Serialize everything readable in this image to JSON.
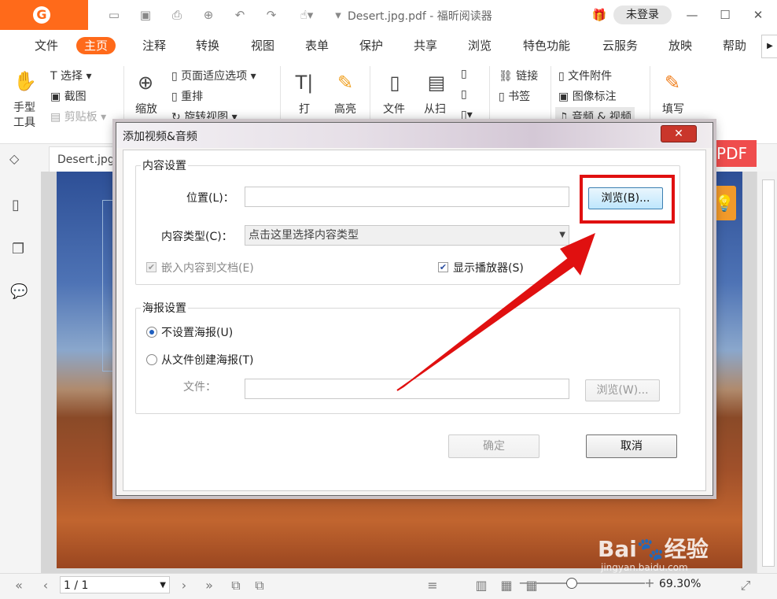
{
  "app": {
    "document_title": "Desert.jpg.pdf - 福昕阅读器",
    "login_label": "未登录"
  },
  "menu": {
    "items": [
      "文件",
      "主页",
      "注释",
      "转换",
      "视图",
      "表单",
      "保护",
      "共享",
      "浏览",
      "特色功能",
      "云服务",
      "放映",
      "帮助"
    ],
    "active": "主页"
  },
  "ribbon": {
    "hand_tool": "手型\n工具",
    "select": "选择",
    "screenshot": "截图",
    "clipboard": "剪贴板",
    "zoom": "缩放",
    "page_fit": "页面适应选项",
    "rearrange": "重排",
    "rotate_view": "旋转视图",
    "typewriter": "打",
    "highlight": "高亮",
    "file_convert": "文件",
    "from_scanner": "从扫",
    "link": "链接",
    "bookmark": "书签",
    "file_attachment": "文件附件",
    "image_annotation": "图像标注",
    "audio_video": "音频 & 视频",
    "fill_sign": "填写"
  },
  "document": {
    "tab_label": "Desert.jpg.",
    "promo_text": "转PDF"
  },
  "statusbar": {
    "page": "1 / 1",
    "zoom": "69.30%",
    "zoom_fraction": 0.33
  },
  "dialog": {
    "title": "添加视频&音频",
    "content_settings": {
      "group_title": "内容设置",
      "location_label": "位置(L)：",
      "location_value": "",
      "browse_label": "浏览(B)...",
      "content_type_label": "内容类型(C)：",
      "content_type_placeholder": "点击这里选择内容类型",
      "embed_label": "嵌入内容到文档(E)",
      "embed_checked": true,
      "show_player_label": "显示播放器(S)",
      "show_player_checked": true
    },
    "poster_settings": {
      "group_title": "海报设置",
      "no_poster_label": "不设置海报(U)",
      "from_file_label": "从文件创建海报(T)",
      "file_label": "文件：",
      "file_value": "",
      "browse_label": "浏览(W)..."
    },
    "ok_label": "确定",
    "cancel_label": "取消"
  },
  "colors": {
    "accent": "#ff6a1a",
    "highlight_red": "#e01010"
  }
}
